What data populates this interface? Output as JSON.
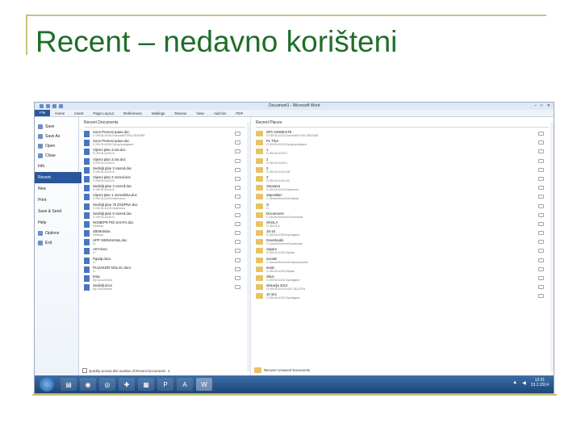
{
  "slide": {
    "title": "Recent – nedavno korišteni"
  },
  "window": {
    "title": "Document1 - Microsoft Word",
    "controls": [
      "–",
      "□",
      "✕"
    ],
    "ribbon_tabs": [
      "File",
      "Home",
      "Insert",
      "Page Layout",
      "References",
      "Mailings",
      "Review",
      "View",
      "Add-Ins",
      "PDF"
    ]
  },
  "backstage_nav": [
    {
      "label": "Save",
      "icon": "save-icon"
    },
    {
      "label": "Save As",
      "icon": "save-as-icon"
    },
    {
      "label": "Open",
      "icon": "open-icon"
    },
    {
      "label": "Close",
      "icon": "close-doc-icon"
    },
    {
      "label": "Info",
      "icon": ""
    },
    {
      "label": "Recent",
      "icon": "",
      "selected": true
    },
    {
      "label": "New",
      "icon": ""
    },
    {
      "label": "Print",
      "icon": ""
    },
    {
      "label": "Save & Send",
      "icon": ""
    },
    {
      "label": "Help",
      "icon": ""
    },
    {
      "label": "Options",
      "icon": "options-icon"
    },
    {
      "label": "Exit",
      "icon": "exit-icon"
    }
  ],
  "recent_documents": {
    "header": "Recent Documents",
    "items": [
      {
        "name": "Sonn Prenesi Ipass.doc",
        "path": "G:\\SKOLA\\2013\\uzoraki\\POGLOBODBE"
      },
      {
        "name": "Sonn Prenesi Ipass.doc",
        "path": "G:\\SKOLA\\2013\\pricp\\polagane..."
      },
      {
        "name": "Vijesni plan 3.ras.doc",
        "path": "G:\\SKOLA\\2014\\"
      },
      {
        "name": "Vijesni plan 3.ras.doc",
        "path": "G:\\SKOLA\\2014\\"
      },
      {
        "name": "Sedisljt plan 3 rasred.doc",
        "path": "G:\\SKOLA\\2014\\"
      },
      {
        "name": "Vijesni plan 3 razred.doc",
        "path": "G:\\SKOLA\\2014\\"
      },
      {
        "name": "Sedisljt plan 3 razred.doc",
        "path": "G:\\SKOLA\\2014\\"
      },
      {
        "name": "Vijesni plan 1 razrednika.doc",
        "path": "G:\\SKOLA\\2014\\skrivena"
      },
      {
        "name": "Sedisljt plan 7k ZSDPNA.doc",
        "path": "G:\\SKOLA\\2014\\skrivena"
      },
      {
        "name": "Sedisljt plan 8 razred.doc",
        "path": "G:\\SKOLA\\2014\\"
      },
      {
        "name": "NOMEPR PDI SAHTA.doc",
        "path": "Desktop"
      },
      {
        "name": "StEMulsisa",
        "path": "Desktop"
      },
      {
        "name": "UPP SIMNAKstus.doc",
        "path": "G:"
      },
      {
        "name": "AKT.docx",
        "path": "G:"
      },
      {
        "name": "Pgsdp.docx",
        "path": "G:"
      },
      {
        "name": "PLIZAKOR NOLAC.docx",
        "path": "G:"
      },
      {
        "name": "Esta",
        "path": "My Documents"
      },
      {
        "name": "Sedisljt.docx",
        "path": "My Documents"
      }
    ],
    "quick_access_label": "Quickly access this number of Recent Documents:",
    "quick_access_count": "4"
  },
  "recent_places": {
    "header": "Recent Places",
    "items": [
      {
        "name": "DPC MODESTE",
        "path": "G:\\SKOLA\\2013\\uzoraki\\POGLOBODBE"
      },
      {
        "name": "PL Tilve",
        "path": "G:\\SKOLA\\2013\\pricp\\polagane"
      },
      {
        "name": "1",
        "path": "G:\\SKOLA\\2013"
      },
      {
        "name": "2",
        "path": "G:\\SKOLA\\2014"
      },
      {
        "name": "3",
        "path": "G:\\SKOLA\\2014\\B"
      },
      {
        "name": "3",
        "path": "G:\\SKOLA\\2014\\V"
      },
      {
        "name": "Stvarava",
        "path": "G:\\SKOLA\\2014\\skrivena"
      },
      {
        "name": "Zaposlitez",
        "path": "C:\\Users\\Severs\\Desktop"
      },
      {
        "name": "G",
        "path": "G:"
      },
      {
        "name": "Documents",
        "path": "C:\\Users\\Severs\\Documents"
      },
      {
        "name": "SKOLA",
        "path": "G:\\SKOLA"
      },
      {
        "name": "15-16",
        "path": "G:\\SKOLA\\2015\\polagane"
      },
      {
        "name": "Downloads",
        "path": "C:\\Users\\Severs\\Downloads"
      },
      {
        "name": "zapam",
        "path": "G:\\SKOLA\\2014\\pisac"
      },
      {
        "name": "socials",
        "path": "C:\\Users\\Severs\\Desktop\\dodaci"
      },
      {
        "name": "svaki",
        "path": "G:\\SKOLA\\2013\\pisac"
      },
      {
        "name": "Stasi",
        "path": "G:\\SKOLA\\2013\\polagane"
      },
      {
        "name": "slokurija 2014",
        "path": "G:\\SKOLA\\2014\\IZA TAZIZON"
      },
      {
        "name": "10 stoi",
        "path": "G:\\SKOLA\\2014\\polagane"
      }
    ],
    "browse_label": "Recover Unsaved Documents"
  },
  "taskbar": {
    "buttons": [
      {
        "name": "explorer",
        "glyph": "▤"
      },
      {
        "name": "firefox",
        "glyph": "◉"
      },
      {
        "name": "chrome",
        "glyph": "◎"
      },
      {
        "name": "app",
        "glyph": "✚"
      },
      {
        "name": "folder",
        "glyph": "▦"
      },
      {
        "name": "powerpoint",
        "glyph": "P"
      },
      {
        "name": "acrobat",
        "glyph": "A"
      },
      {
        "name": "word",
        "glyph": "W",
        "active": true
      }
    ],
    "time": "12:31",
    "date": "23.2.2014"
  }
}
